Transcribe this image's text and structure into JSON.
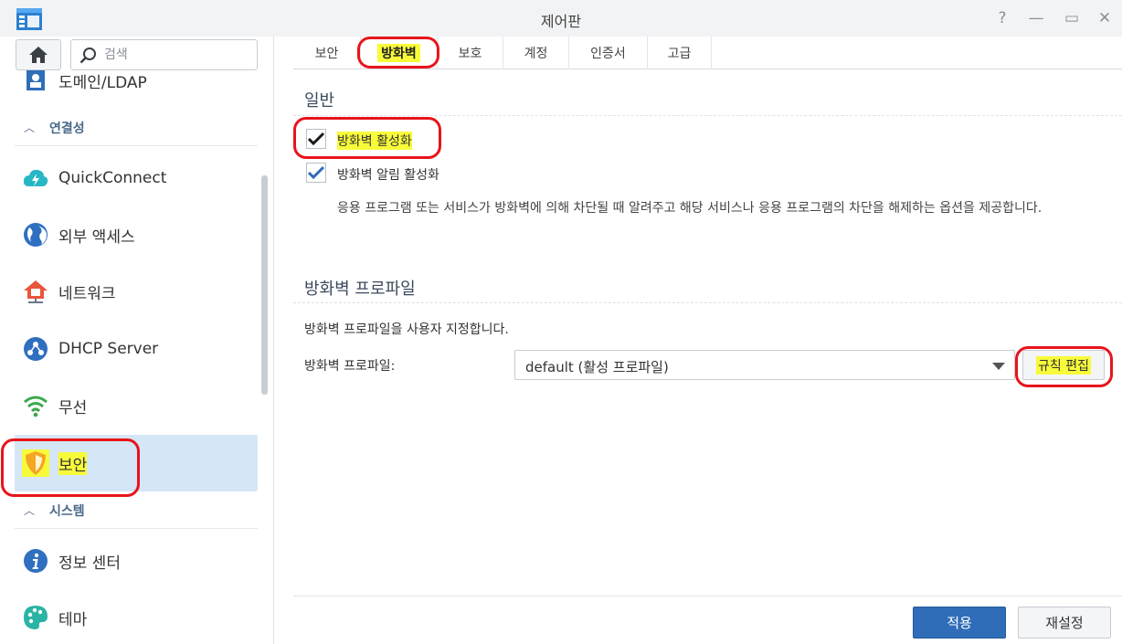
{
  "window": {
    "title": "제어판",
    "controls": {
      "help": "?",
      "minimize": "—",
      "maximize": "▭",
      "close": "✕"
    }
  },
  "sidebar": {
    "search": {
      "placeholder": "검색",
      "value": ""
    },
    "items": [
      {
        "label": "도메인/LDAP",
        "icon": "domain-ldap-icon"
      },
      {
        "label": "연결성",
        "type": "group"
      },
      {
        "label": "QuickConnect",
        "icon": "quickconnect-icon"
      },
      {
        "label": "외부 액세스",
        "icon": "globe-icon"
      },
      {
        "label": "네트워크",
        "icon": "network-house-icon"
      },
      {
        "label": "DHCP Server",
        "icon": "dhcp-icon"
      },
      {
        "label": "무선",
        "icon": "wifi-icon"
      },
      {
        "label": "보안",
        "icon": "shield-icon",
        "active": true
      },
      {
        "label": "시스템",
        "type": "group"
      },
      {
        "label": "정보 센터",
        "icon": "info-icon"
      },
      {
        "label": "테마",
        "icon": "palette-icon"
      }
    ]
  },
  "tabs": [
    {
      "label": "보안"
    },
    {
      "label": "방화벽",
      "active": true
    },
    {
      "label": "보호"
    },
    {
      "label": "계정"
    },
    {
      "label": "인증서"
    },
    {
      "label": "고급"
    }
  ],
  "general": {
    "title": "일반",
    "enable_firewall": {
      "label": "방화벽 활성화",
      "checked": true
    },
    "enable_notify": {
      "label": "방화벽 알림 활성화",
      "checked": true
    },
    "description": "응용 프로그램 또는 서비스가 방화벽에 의해 차단될 때 알려주고 해당 서비스나 응용 프로그램의 차단을 해제하는 옵션을 제공합니다."
  },
  "profile": {
    "title": "방화벽 프로파일",
    "subtitle": "방화벽 프로파일을 사용자 지정합니다.",
    "field_label": "방화벽 프로파일:",
    "selected": "default (활성 프로파일)",
    "edit_rules_label": "규칙 편집"
  },
  "footer": {
    "apply_label": "적용",
    "reset_label": "재설정"
  },
  "colors": {
    "accent": "#2f6db8",
    "highlight": "#f8fb3a",
    "annotation": "#e8141b",
    "active_nav": "#d5e6f7"
  }
}
